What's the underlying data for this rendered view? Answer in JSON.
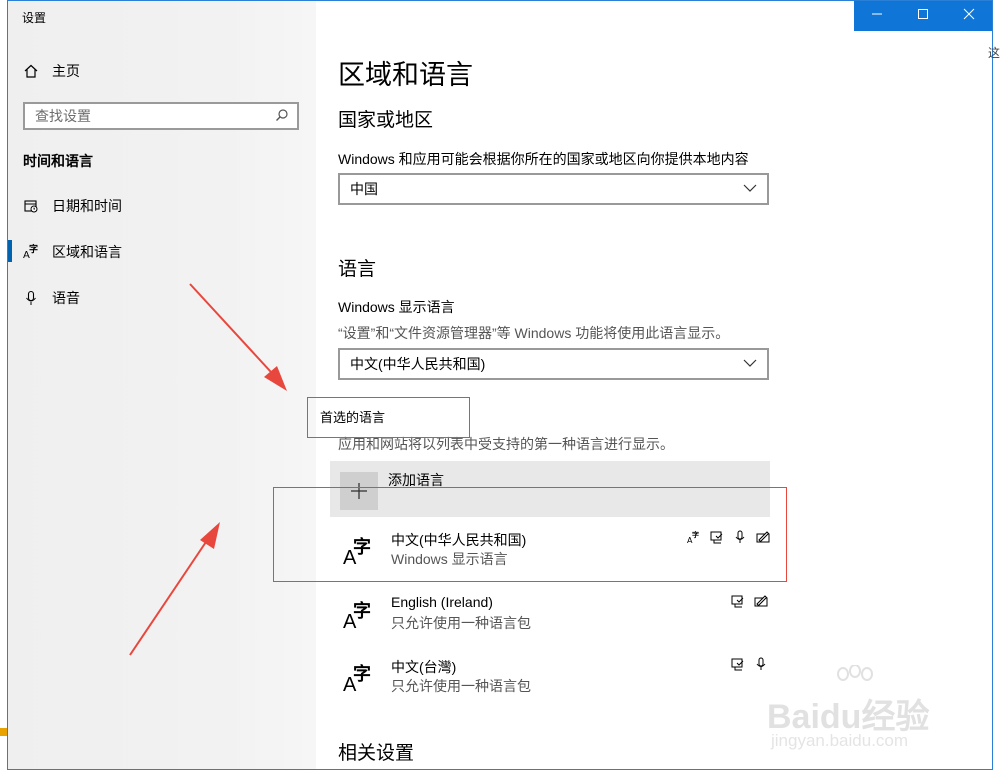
{
  "window": {
    "title": "设置",
    "controls": [
      "minimize-icon",
      "maximize-icon",
      "close-icon"
    ]
  },
  "sidebar": {
    "home_label": "主页",
    "search_placeholder": "查找设置",
    "section_heading": "时间和语言",
    "items": [
      {
        "label": "日期和时间",
        "icon": "calendar-clock-icon",
        "selected": false
      },
      {
        "label": "区域和语言",
        "icon": "region-language-icon",
        "selected": true
      },
      {
        "label": "语音",
        "icon": "microphone-icon",
        "selected": false
      }
    ]
  },
  "main": {
    "title": "区域和语言",
    "country": {
      "heading": "国家或地区",
      "desc": "Windows 和应用可能会根据你所在的国家或地区向你提供本地内容",
      "value": "中国"
    },
    "language": {
      "heading": "语言",
      "display_label": "Windows 显示语言",
      "display_desc": "“设置”和“文件资源管理器”等 Windows 功能将使用此语言显示。",
      "display_value": "中文(中华人民共和国)",
      "preferred_heading": "首选的语言",
      "preferred_desc": "应用和网站将以列表中受支持的第一种语言进行显示。",
      "add_label": "添加语言",
      "add_icon": "plus-icon",
      "languages": [
        {
          "name": "中文(中华人民共和国)",
          "desc": "Windows 显示语言",
          "features": [
            "display-language-icon",
            "text-to-speech-icon",
            "speech-icon",
            "handwriting-icon"
          ]
        },
        {
          "name": "English (Ireland)",
          "desc": "只允许使用一种语言包",
          "features": [
            "text-to-speech-icon",
            "handwriting-icon"
          ]
        },
        {
          "name": "中文(台灣)",
          "desc": "只允许使用一种语言包",
          "features": [
            "text-to-speech-icon",
            "speech-icon"
          ]
        }
      ]
    },
    "related_heading": "相关设置"
  },
  "watermark": {
    "main": "Baidu经验",
    "sub": "jingyan.baidu.com"
  },
  "edge_char": "这",
  "colors": {
    "accent": "#0f75d6",
    "annotation_red": "#e8473d"
  }
}
